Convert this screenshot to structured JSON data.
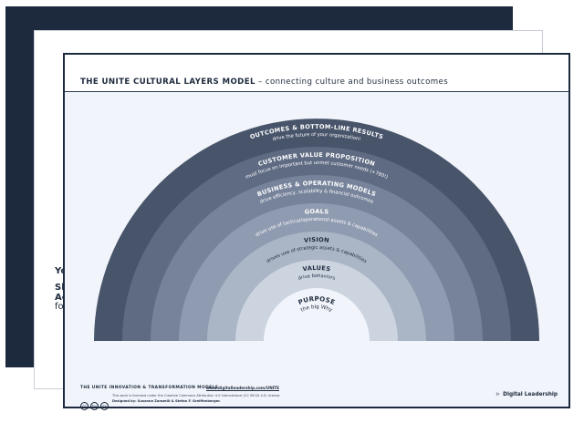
{
  "middle_sheet": {
    "line1": "Yo",
    "line2": "Sh",
    "line3": "Ac",
    "line4": "fo"
  },
  "header": {
    "title_bold": "THE UNITE CULTURAL LAYERS MODEL",
    "title_rest": " – connecting culture and business outcomes"
  },
  "diagram": {
    "center": {
      "label": "PURPOSE",
      "sub": "the big Why"
    },
    "layers": [
      {
        "name": "VALUES",
        "sub": "drive behaviors",
        "color": "#ccd4e0"
      },
      {
        "name": "VISION",
        "sub": "drives use of strategic assets & capabilities",
        "color": "#aab5c6"
      },
      {
        "name": "GOALS",
        "sub": "drive use of tactical/operational assets & capabilities",
        "color": "#8f9bb0"
      },
      {
        "name": "BUSINESS & OPERATING MODELS",
        "sub": "drive efficiency, scalability & financial outcomes",
        "color": "#76839a"
      },
      {
        "name": "CUSTOMER VALUE PROPOSITION",
        "sub": "must focus on important but unmet customer needs (+780!)",
        "color": "#5e6b82"
      },
      {
        "name": "OUTCOMES & BOTTOM-LINE RESULTS",
        "sub": "drive the future of your organization!",
        "color": "#47546a"
      }
    ],
    "colors": {
      "center": "#f1f4fa",
      "text_light": "#ffffff",
      "text_dark": "#1d2a3d"
    }
  },
  "footer": {
    "series": "THE UNITE INNOVATION & TRANSFORMATION MODELS",
    "url": "www.digitalleadership.com/UNITE",
    "license": "This work is licensed under the Creative Commons Attribution 4.0 International (CC BY-SA 4.0) license.",
    "credit": "Designed by: Susanne Zamzelli & Stefan F. Greiffenberger.",
    "icons": [
      "cc",
      "by",
      "sa"
    ],
    "brand": "Digital Leadership",
    "brand_mark": "⊳"
  }
}
